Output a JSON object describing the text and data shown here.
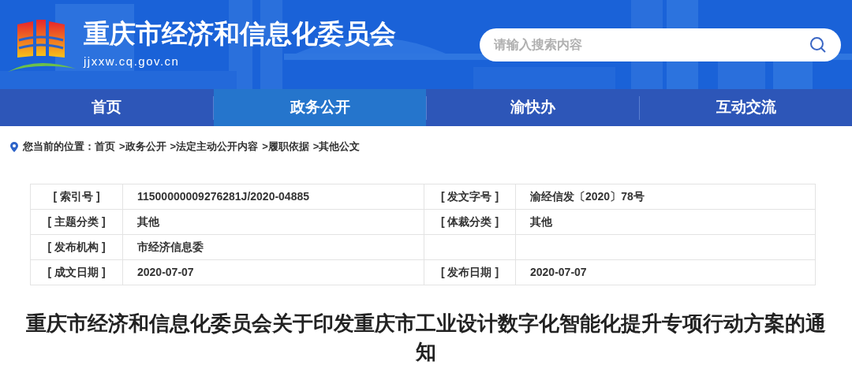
{
  "header": {
    "site_name": "重庆市经济和信息化委员会",
    "domain": "jjxxw.cq.gov.cn",
    "search": {
      "placeholder": "请输入搜索内容"
    }
  },
  "nav": [
    {
      "label": "首页",
      "selected": false
    },
    {
      "label": "政务公开",
      "selected": true
    },
    {
      "label": "渝快办",
      "selected": false
    },
    {
      "label": "互动交流",
      "selected": false
    }
  ],
  "breadcrumb": {
    "label": "您当前的位置：",
    "items": [
      "首页",
      ">政务公开",
      ">法定主动公开内容",
      ">履职依据",
      ">其他公文"
    ]
  },
  "info_table": {
    "rows": [
      {
        "label_1": "[ 索引号 ]",
        "value_1": "11500000009276281J/2020-04885",
        "label_2": "[ 发文字号 ]",
        "value_2": "渝经信发〔2020〕78号"
      },
      {
        "label_1": "[ 主题分类 ]",
        "value_1": "其他",
        "label_2": "[ 体裁分类 ]",
        "value_2": "其他"
      },
      {
        "label_1": "[ 发布机构 ]",
        "value_1": "市经济信息委"
      },
      {
        "label_1": "[ 成文日期 ]",
        "value_1": "2020-07-07",
        "label_2": "[ 发布日期 ]",
        "value_2": "2020-07-07"
      }
    ]
  },
  "article_title": "重庆市经济和信息化委员会关于印发重庆市工业设计数字化智能化提升专项行动方案的通知"
}
